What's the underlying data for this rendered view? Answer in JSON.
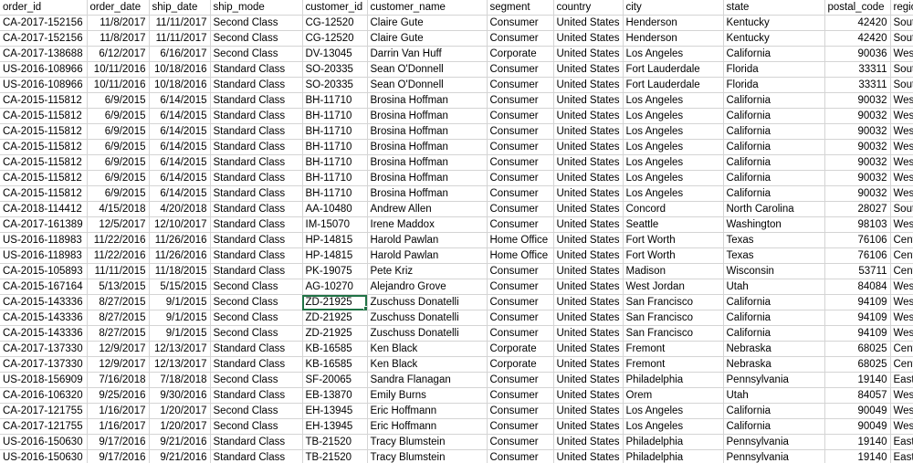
{
  "sheet": {
    "headers": [
      "order_id",
      "order_date",
      "ship_date",
      "ship_mode",
      "customer_id",
      "customer_name",
      "segment",
      "country",
      "city",
      "state",
      "postal_code",
      "region"
    ],
    "numeric_columns": [
      1,
      2,
      10
    ],
    "selected_cell": {
      "row": 19,
      "col": 4
    },
    "selection_color": "#217346",
    "gridline_color": "#d4d4d4",
    "rows": [
      [
        "CA-2017-152156",
        "11/8/2017",
        "11/11/2017",
        "Second Class",
        "CG-12520",
        "Claire Gute",
        "Consumer",
        "United States",
        "Henderson",
        "Kentucky",
        "42420",
        "South"
      ],
      [
        "CA-2017-152156",
        "11/8/2017",
        "11/11/2017",
        "Second Class",
        "CG-12520",
        "Claire Gute",
        "Consumer",
        "United States",
        "Henderson",
        "Kentucky",
        "42420",
        "South"
      ],
      [
        "CA-2017-138688",
        "6/12/2017",
        "6/16/2017",
        "Second Class",
        "DV-13045",
        "Darrin Van Huff",
        "Corporate",
        "United States",
        "Los Angeles",
        "California",
        "90036",
        "West"
      ],
      [
        "US-2016-108966",
        "10/11/2016",
        "10/18/2016",
        "Standard Class",
        "SO-20335",
        "Sean O'Donnell",
        "Consumer",
        "United States",
        "Fort Lauderdale",
        "Florida",
        "33311",
        "South"
      ],
      [
        "US-2016-108966",
        "10/11/2016",
        "10/18/2016",
        "Standard Class",
        "SO-20335",
        "Sean O'Donnell",
        "Consumer",
        "United States",
        "Fort Lauderdale",
        "Florida",
        "33311",
        "South"
      ],
      [
        "CA-2015-115812",
        "6/9/2015",
        "6/14/2015",
        "Standard Class",
        "BH-11710",
        "Brosina Hoffman",
        "Consumer",
        "United States",
        "Los Angeles",
        "California",
        "90032",
        "West"
      ],
      [
        "CA-2015-115812",
        "6/9/2015",
        "6/14/2015",
        "Standard Class",
        "BH-11710",
        "Brosina Hoffman",
        "Consumer",
        "United States",
        "Los Angeles",
        "California",
        "90032",
        "West"
      ],
      [
        "CA-2015-115812",
        "6/9/2015",
        "6/14/2015",
        "Standard Class",
        "BH-11710",
        "Brosina Hoffman",
        "Consumer",
        "United States",
        "Los Angeles",
        "California",
        "90032",
        "West"
      ],
      [
        "CA-2015-115812",
        "6/9/2015",
        "6/14/2015",
        "Standard Class",
        "BH-11710",
        "Brosina Hoffman",
        "Consumer",
        "United States",
        "Los Angeles",
        "California",
        "90032",
        "West"
      ],
      [
        "CA-2015-115812",
        "6/9/2015",
        "6/14/2015",
        "Standard Class",
        "BH-11710",
        "Brosina Hoffman",
        "Consumer",
        "United States",
        "Los Angeles",
        "California",
        "90032",
        "West"
      ],
      [
        "CA-2015-115812",
        "6/9/2015",
        "6/14/2015",
        "Standard Class",
        "BH-11710",
        "Brosina Hoffman",
        "Consumer",
        "United States",
        "Los Angeles",
        "California",
        "90032",
        "West"
      ],
      [
        "CA-2015-115812",
        "6/9/2015",
        "6/14/2015",
        "Standard Class",
        "BH-11710",
        "Brosina Hoffman",
        "Consumer",
        "United States",
        "Los Angeles",
        "California",
        "90032",
        "West"
      ],
      [
        "CA-2018-114412",
        "4/15/2018",
        "4/20/2018",
        "Standard Class",
        "AA-10480",
        "Andrew Allen",
        "Consumer",
        "United States",
        "Concord",
        "North Carolina",
        "28027",
        "South"
      ],
      [
        "CA-2017-161389",
        "12/5/2017",
        "12/10/2017",
        "Standard Class",
        "IM-15070",
        "Irene Maddox",
        "Consumer",
        "United States",
        "Seattle",
        "Washington",
        "98103",
        "West"
      ],
      [
        "US-2016-118983",
        "11/22/2016",
        "11/26/2016",
        "Standard Class",
        "HP-14815",
        "Harold Pawlan",
        "Home Office",
        "United States",
        "Fort Worth",
        "Texas",
        "76106",
        "Central"
      ],
      [
        "US-2016-118983",
        "11/22/2016",
        "11/26/2016",
        "Standard Class",
        "HP-14815",
        "Harold Pawlan",
        "Home Office",
        "United States",
        "Fort Worth",
        "Texas",
        "76106",
        "Central"
      ],
      [
        "CA-2015-105893",
        "11/11/2015",
        "11/18/2015",
        "Standard Class",
        "PK-19075",
        "Pete Kriz",
        "Consumer",
        "United States",
        "Madison",
        "Wisconsin",
        "53711",
        "Central"
      ],
      [
        "CA-2015-167164",
        "5/13/2015",
        "5/15/2015",
        "Second Class",
        "AG-10270",
        "Alejandro Grove",
        "Consumer",
        "United States",
        "West Jordan",
        "Utah",
        "84084",
        "West"
      ],
      [
        "CA-2015-143336",
        "8/27/2015",
        "9/1/2015",
        "Second Class",
        "ZD-21925",
        "Zuschuss Donatelli",
        "Consumer",
        "United States",
        "San Francisco",
        "California",
        "94109",
        "West"
      ],
      [
        "CA-2015-143336",
        "8/27/2015",
        "9/1/2015",
        "Second Class",
        "ZD-21925",
        "Zuschuss Donatelli",
        "Consumer",
        "United States",
        "San Francisco",
        "California",
        "94109",
        "West"
      ],
      [
        "CA-2015-143336",
        "8/27/2015",
        "9/1/2015",
        "Second Class",
        "ZD-21925",
        "Zuschuss Donatelli",
        "Consumer",
        "United States",
        "San Francisco",
        "California",
        "94109",
        "West"
      ],
      [
        "CA-2017-137330",
        "12/9/2017",
        "12/13/2017",
        "Standard Class",
        "KB-16585",
        "Ken Black",
        "Corporate",
        "United States",
        "Fremont",
        "Nebraska",
        "68025",
        "Central"
      ],
      [
        "CA-2017-137330",
        "12/9/2017",
        "12/13/2017",
        "Standard Class",
        "KB-16585",
        "Ken Black",
        "Corporate",
        "United States",
        "Fremont",
        "Nebraska",
        "68025",
        "Central"
      ],
      [
        "US-2018-156909",
        "7/16/2018",
        "7/18/2018",
        "Second Class",
        "SF-20065",
        "Sandra Flanagan",
        "Consumer",
        "United States",
        "Philadelphia",
        "Pennsylvania",
        "19140",
        "East"
      ],
      [
        "CA-2016-106320",
        "9/25/2016",
        "9/30/2016",
        "Standard Class",
        "EB-13870",
        "Emily Burns",
        "Consumer",
        "United States",
        "Orem",
        "Utah",
        "84057",
        "West"
      ],
      [
        "CA-2017-121755",
        "1/16/2017",
        "1/20/2017",
        "Second Class",
        "EH-13945",
        "Eric Hoffmann",
        "Consumer",
        "United States",
        "Los Angeles",
        "California",
        "90049",
        "West"
      ],
      [
        "CA-2017-121755",
        "1/16/2017",
        "1/20/2017",
        "Second Class",
        "EH-13945",
        "Eric Hoffmann",
        "Consumer",
        "United States",
        "Los Angeles",
        "California",
        "90049",
        "West"
      ],
      [
        "US-2016-150630",
        "9/17/2016",
        "9/21/2016",
        "Standard Class",
        "TB-21520",
        "Tracy Blumstein",
        "Consumer",
        "United States",
        "Philadelphia",
        "Pennsylvania",
        "19140",
        "East"
      ],
      [
        "US-2016-150630",
        "9/17/2016",
        "9/21/2016",
        "Standard Class",
        "TB-21520",
        "Tracy Blumstein",
        "Consumer",
        "United States",
        "Philadelphia",
        "Pennsylvania",
        "19140",
        "East"
      ]
    ]
  }
}
